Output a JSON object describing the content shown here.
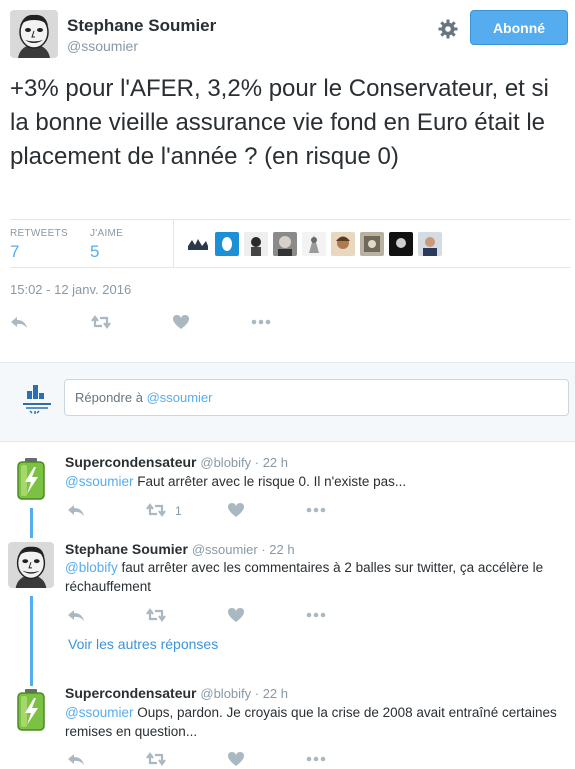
{
  "header": {
    "author_name": "Stephane Soumier",
    "author_handle": "@ssoumier",
    "follow_label": "Abonné"
  },
  "tweet": {
    "text": "+3% pour l'AFER, 3,2% pour le Conservateur, et si la bonne vieille assurance vie fond en Euro était le placement de l'année ? (en risque 0)",
    "retweets_label": "RETWEETS",
    "retweets_count": "7",
    "likes_label": "J'AIME",
    "likes_count": "5",
    "timestamp": "15:02 - 12 janv. 2016"
  },
  "reply_box": {
    "prefix": "Répondre à ",
    "mention": "@ssoumier"
  },
  "replies": [
    {
      "name": "Supercondensateur",
      "meta": "@blobify · 22 h",
      "mention": "@ssoumier",
      "text": " Faut arrêter avec le risque 0. Il n'existe pas...",
      "retweet_count": "1"
    },
    {
      "name": "Stephane Soumier",
      "meta": "@ssoumier · 22 h",
      "mention": "@blobify",
      "text": " faut arrêter avec les commentaires à 2 balles sur twitter, ça accélère le réchauffement",
      "retweet_count": ""
    },
    {
      "name": "Supercondensateur",
      "meta": "@blobify · 22 h",
      "mention": "@ssoumier",
      "text": " Oups, pardon. Je croyais que la crise de 2008 avait entraîné certaines remises en question...",
      "retweet_count": ""
    }
  ],
  "more_replies_label": "Voir les autres réponses",
  "icons": [
    "settings-gear-icon",
    "reply-icon",
    "retweet-icon",
    "like-heart-icon",
    "more-dots-icon",
    "battery-avatar-icon",
    "reply-logo-icon"
  ],
  "colors": {
    "accent": "#55acee",
    "text": "#292f33",
    "muted": "#8899a6",
    "battery_green": "#7bc143"
  }
}
